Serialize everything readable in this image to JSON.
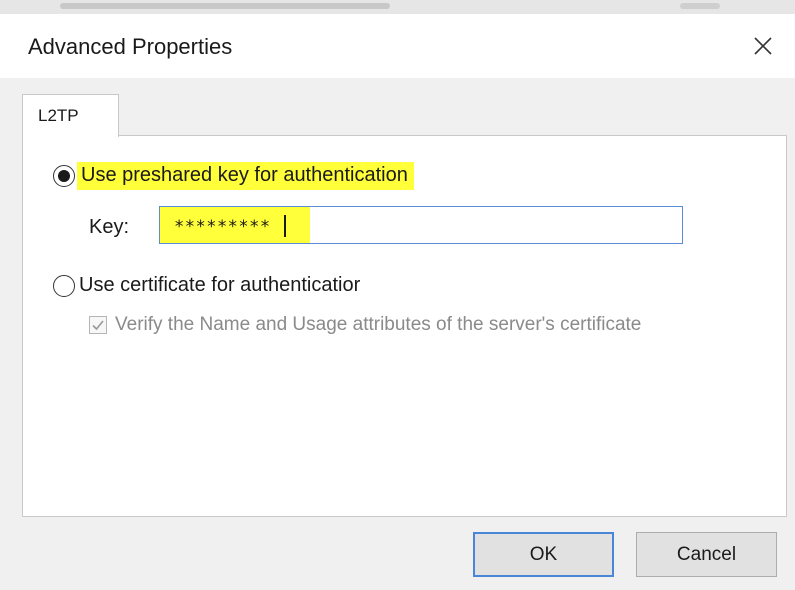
{
  "dialog": {
    "title": "Advanced Properties"
  },
  "tabs": [
    {
      "label": "L2TP",
      "selected": true
    }
  ],
  "auth": {
    "preshared_label": "Use preshared key for authentication",
    "preshared_selected": true,
    "key_label": "Key:",
    "key_value": "*********",
    "certificate_label": "Use certificate for authenticatior",
    "certificate_selected": false,
    "verify_label": "Verify the Name and Usage attributes of the server's certificate",
    "verify_checked": true,
    "verify_enabled": false
  },
  "buttons": {
    "ok": "OK",
    "cancel": "Cancel"
  },
  "colors": {
    "highlight": "#ffff3a",
    "focus_border": "#4a86d8"
  }
}
